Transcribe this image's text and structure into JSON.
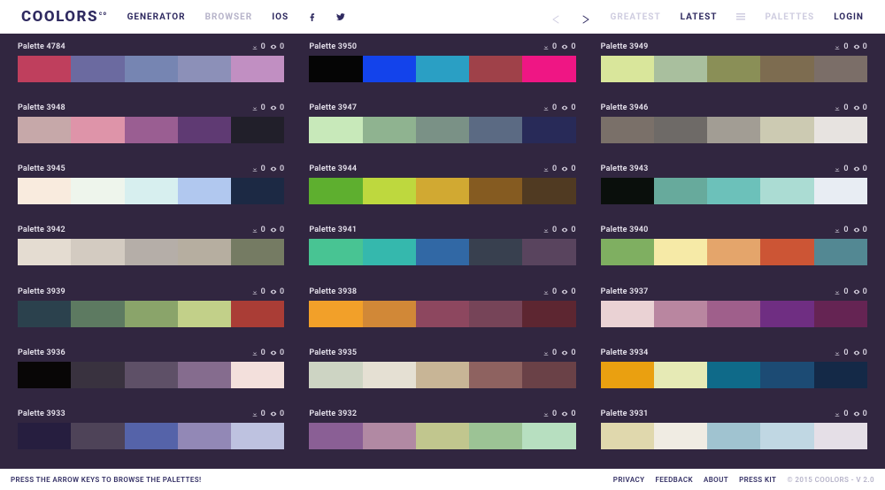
{
  "header": {
    "logo": "COOLORS",
    "nav": {
      "generator": "GENERATOR",
      "browser": "BROWSER",
      "ios": "IOS"
    },
    "right": {
      "greatest": "GREATEST",
      "latest": "LATEST",
      "palettes": "PALETTES",
      "login": "LOGIN"
    }
  },
  "palettes": [
    {
      "name": "Palette 4784",
      "downloads": 0,
      "views": 0,
      "colors": [
        "#bf3f5d",
        "#6b6aa0",
        "#7685b2",
        "#8c90b8",
        "#c18fc2"
      ]
    },
    {
      "name": "Palette 3950",
      "downloads": 0,
      "views": 0,
      "colors": [
        "#050505",
        "#1343eb",
        "#2a9fc4",
        "#9f4149",
        "#ef1684"
      ]
    },
    {
      "name": "Palette 3949",
      "downloads": 0,
      "views": 0,
      "colors": [
        "#d9e69b",
        "#a9bf9e",
        "#8a8f57",
        "#7d6c50",
        "#7b6e68"
      ]
    },
    {
      "name": "Palette 3948",
      "downloads": 0,
      "views": 0,
      "colors": [
        "#c6a8a9",
        "#de94a9",
        "#9a5e92",
        "#5f3a73",
        "#211f2a"
      ]
    },
    {
      "name": "Palette 3947",
      "downloads": 0,
      "views": 0,
      "colors": [
        "#c8e9ba",
        "#8fb390",
        "#7a9186",
        "#5b6a83",
        "#282a58"
      ]
    },
    {
      "name": "Palette 3946",
      "downloads": 0,
      "views": 0,
      "colors": [
        "#7a7069",
        "#6e6a67",
        "#a29d94",
        "#cccab2",
        "#e7e3e0"
      ]
    },
    {
      "name": "Palette 3945",
      "downloads": 0,
      "views": 0,
      "colors": [
        "#f9ebde",
        "#eef5ec",
        "#d7efef",
        "#b1c8ef",
        "#1c2944"
      ]
    },
    {
      "name": "Palette 3944",
      "downloads": 0,
      "views": 0,
      "colors": [
        "#5eaf2f",
        "#bed83e",
        "#d1a932",
        "#855b21",
        "#503a22"
      ]
    },
    {
      "name": "Palette 3943",
      "downloads": 0,
      "views": 0,
      "colors": [
        "#0a0f0c",
        "#67aa9c",
        "#6cc1ba",
        "#abdcd3",
        "#e8edf3"
      ]
    },
    {
      "name": "Palette 3942",
      "downloads": 0,
      "views": 0,
      "colors": [
        "#e4dcd1",
        "#d3cbc1",
        "#b5aea8",
        "#b6aea0",
        "#757b63"
      ]
    },
    {
      "name": "Palette 3941",
      "downloads": 0,
      "views": 0,
      "colors": [
        "#48c493",
        "#35b8ad",
        "#3168a5",
        "#38404f",
        "#59445e"
      ]
    },
    {
      "name": "Palette 3940",
      "downloads": 0,
      "views": 0,
      "colors": [
        "#7faf61",
        "#f6eaa7",
        "#e4a56b",
        "#cc5535",
        "#538893"
      ]
    },
    {
      "name": "Palette 3939",
      "downloads": 0,
      "views": 0,
      "colors": [
        "#2b414d",
        "#5d7a61",
        "#8aa46a",
        "#c2d089",
        "#aa3d36"
      ]
    },
    {
      "name": "Palette 3938",
      "downloads": 0,
      "views": 0,
      "colors": [
        "#f2a029",
        "#d18837",
        "#8d475f",
        "#764458",
        "#5d2631"
      ]
    },
    {
      "name": "Palette 3937",
      "downloads": 0,
      "views": 0,
      "colors": [
        "#ead2d4",
        "#b986a0",
        "#9f5f8b",
        "#6f2e82",
        "#652453"
      ]
    },
    {
      "name": "Palette 3936",
      "downloads": 0,
      "views": 0,
      "colors": [
        "#080606",
        "#39323f",
        "#5e5067",
        "#856c8e",
        "#f3e0dc"
      ]
    },
    {
      "name": "Palette 3935",
      "downloads": 0,
      "views": 0,
      "colors": [
        "#cdd4c3",
        "#e5e0d3",
        "#c8b596",
        "#8e6260",
        "#6a4147"
      ]
    },
    {
      "name": "Palette 3934",
      "downloads": 0,
      "views": 0,
      "colors": [
        "#eaa010",
        "#e6eab5",
        "#0f6a89",
        "#1c4b74",
        "#142947"
      ]
    },
    {
      "name": "Palette 3933",
      "downloads": 0,
      "views": 0,
      "colors": [
        "#261e3f",
        "#4e4358",
        "#5563a9",
        "#9288b6",
        "#bec2e0"
      ]
    },
    {
      "name": "Palette 3932",
      "downloads": 0,
      "views": 0,
      "colors": [
        "#8a5f95",
        "#b189a3",
        "#c1c68e",
        "#9cc395",
        "#b7dfc0"
      ]
    },
    {
      "name": "Palette 3931",
      "downloads": 0,
      "views": 0,
      "colors": [
        "#e0d8ad",
        "#f0ece3",
        "#a0c3d0",
        "#c0d7e3",
        "#e5dfe7"
      ]
    }
  ],
  "footer": {
    "tip": "PRESS THE ARROW KEYS TO BROWSE THE PALETTES!",
    "links": {
      "privacy": "PRIVACY",
      "feedback": "FEEDBACK",
      "about": "ABOUT",
      "presskit": "PRESS KIT"
    },
    "copyright": "© 2015 COOLORS - V 2.0"
  }
}
